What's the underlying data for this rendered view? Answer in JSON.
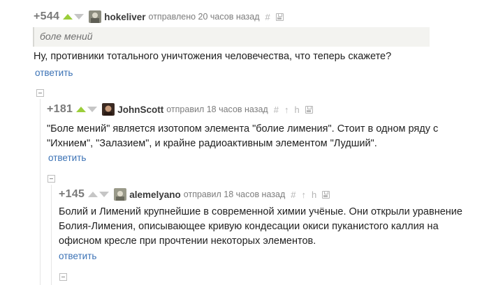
{
  "comments": [
    {
      "rating": "+544",
      "username": "hokeliver",
      "meta": "отправлено 20 часов назад",
      "tools": [
        "#"
      ],
      "quote": "боле мений",
      "text": [
        "Ну, противники тотального уничтожения человечества, что теперь скажете?"
      ],
      "reply": "ответить"
    },
    {
      "rating": "+181",
      "username": "JohnScott",
      "meta": "отправил 18 часов назад",
      "tools": [
        "#",
        "↑",
        "h"
      ],
      "text": [
        "\"Боле мений\" является изотопом элемента \"болие лимения\". Стоит в одном ряду с",
        "\"Ихнием\", \"Залазием\", и крайне радиоактивным элементом \"Лудший\"."
      ],
      "reply": "ответить"
    },
    {
      "rating": "+145",
      "username": "alemelyano",
      "meta": "отправил 18 часов назад",
      "tools": [
        "#",
        "↑",
        "h"
      ],
      "text": [
        "Болий и Лимений крупнейшие в современной химии учёные. Они открыли уравнение",
        "Болия-Лимения, описывающее кривую кондесации окиси пуканистого каллия на",
        "офисном кресле при прочтении некоторых элементов."
      ],
      "reply": "ответить"
    }
  ],
  "colors": {
    "vote_up": "#9bce3a",
    "vote_down": "#c6c6c6",
    "link": "#3b72b5"
  }
}
